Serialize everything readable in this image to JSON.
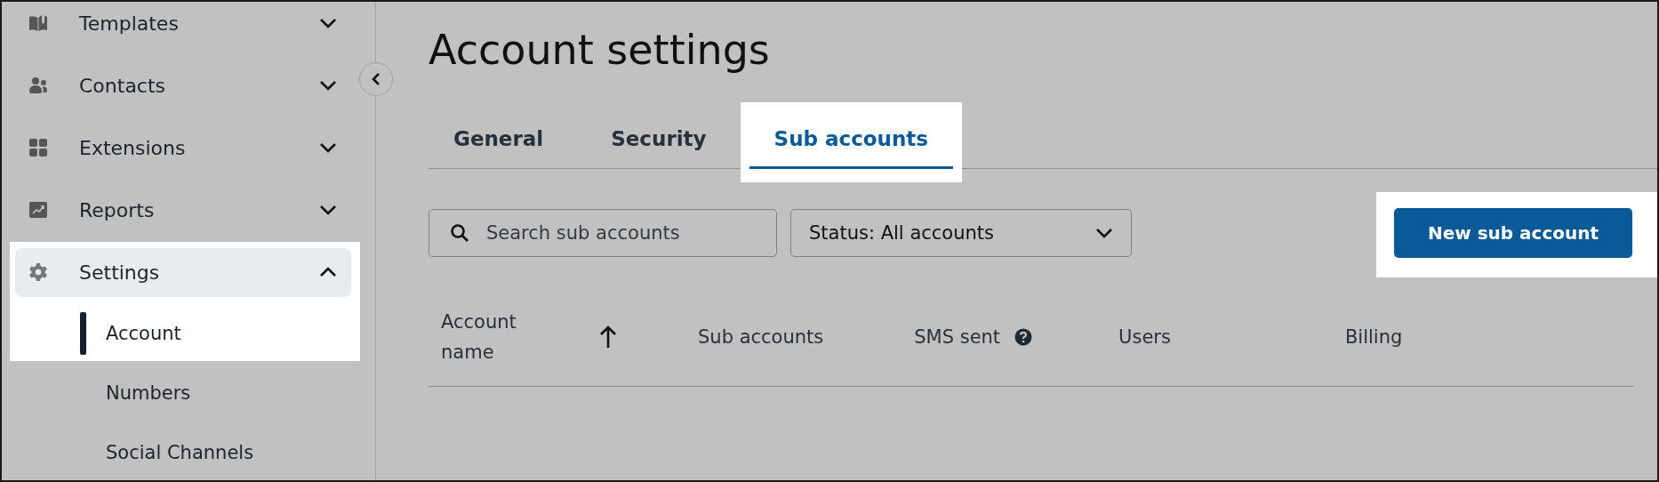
{
  "sidebar": {
    "items": [
      {
        "label": "Templates",
        "expanded": false,
        "selected": false,
        "highlighted": false
      },
      {
        "label": "Contacts",
        "expanded": false,
        "selected": false,
        "highlighted": false
      },
      {
        "label": "Extensions",
        "expanded": false,
        "selected": false,
        "highlighted": false
      },
      {
        "label": "Reports",
        "expanded": false,
        "selected": false,
        "highlighted": false
      },
      {
        "label": "Settings",
        "expanded": true,
        "selected": true,
        "highlighted": true,
        "children": [
          {
            "label": "Account",
            "selected": true,
            "highlighted": true
          },
          {
            "label": "Numbers",
            "selected": false,
            "highlighted": false
          },
          {
            "label": "Social Channels",
            "selected": false,
            "highlighted": false
          }
        ]
      }
    ]
  },
  "page": {
    "title": "Account settings"
  },
  "tabs": [
    {
      "label": "General",
      "selected": false,
      "highlighted": false
    },
    {
      "label": "Security",
      "selected": false,
      "highlighted": false
    },
    {
      "label": "Sub accounts",
      "selected": true,
      "highlighted": true
    }
  ],
  "search": {
    "placeholder": "Search sub accounts"
  },
  "status_filter": {
    "value": "Status: All accounts"
  },
  "new_button": {
    "label": "New sub account",
    "highlighted": true
  },
  "table": {
    "columns": [
      {
        "label": "Account name",
        "sorted": true,
        "help": false
      },
      {
        "label": "Sub accounts",
        "sorted": false,
        "help": false
      },
      {
        "label": "SMS sent",
        "sorted": false,
        "help": true
      },
      {
        "label": "Users",
        "sorted": false,
        "help": false
      },
      {
        "label": "Billing",
        "sorted": false,
        "help": false
      }
    ]
  }
}
